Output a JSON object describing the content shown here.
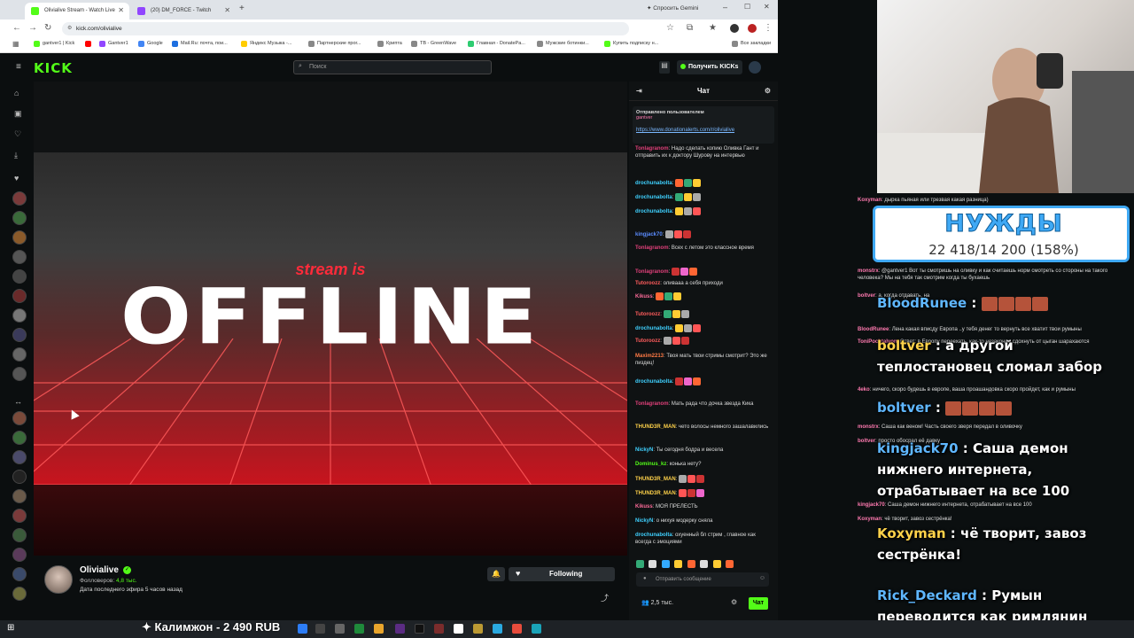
{
  "browser": {
    "tabs": [
      {
        "label": "Olivialive Stream - Watch Live",
        "color": "#53fc18"
      },
      {
        "label": "(20) DM_FORCE - Twitch",
        "color": "#9146ff"
      }
    ],
    "new_tab": "+",
    "gemini_label": "Спросить Gemini",
    "url": "kick.com/olivialive",
    "bookmarks": [
      {
        "label": "gantver1 | Kick",
        "color": "#53fc18"
      },
      {
        "label": "",
        "color": "#ff0000"
      },
      {
        "label": "Gantver1",
        "color": "#9146ff"
      },
      {
        "label": "Google",
        "color": "#4285f4"
      },
      {
        "label": "Mail.Ru: почта, пои...",
        "color": "#1d6fe0"
      },
      {
        "label": "Яндекс Музыка -...",
        "color": "#ffcc00"
      },
      {
        "label": "Партнерские прог...",
        "color": "#888888"
      },
      {
        "label": "Крипта",
        "color": "#888888"
      },
      {
        "label": "TB - GreenWave",
        "color": "#888888"
      },
      {
        "label": "Главная - DonatePa...",
        "color": "#2ecc71"
      },
      {
        "label": "Мужские ботинки...",
        "color": "#888888"
      },
      {
        "label": "Купить подписку н...",
        "color": "#53fc18"
      },
      {
        "label": "Все закладки",
        "color": "#888888"
      }
    ]
  },
  "kick": {
    "logo": "KICK",
    "search_placeholder": "Поиск",
    "get_kicks": "Получить KICKs"
  },
  "video": {
    "stream_is": "stream is",
    "offline": "OFFLINE"
  },
  "channel": {
    "name": "Olivialive",
    "followers_label": "Фолловеров:",
    "followers_value": "4,8 тыс.",
    "last_live": "Дата последнего эфира 5 часов назад",
    "follow_label": "Following"
  },
  "chat": {
    "title": "Чат",
    "pinned_by": "Отправлено пользователем",
    "pinned_user": "gantver",
    "pinned_link": "https://www.donationalerts.com/r/olivialive",
    "messages": [
      {
        "user": "Tonlagranom",
        "color": "#e0407a",
        "text": "Надо сделать копию Оливка Гант и отправить их к доктору Шурову на интервью"
      },
      {
        "user": "drochunabolta",
        "color": "#3fd1ff",
        "text": ""
      },
      {
        "user": "drochunabolta",
        "color": "#3fd1ff",
        "text": ""
      },
      {
        "user": "drochunabolta",
        "color": "#3fd1ff",
        "text": ""
      },
      {
        "user": "kingjack70",
        "color": "#5b8cff",
        "text": ""
      },
      {
        "user": "Tonlagranom",
        "color": "#e0407a",
        "text": "Всех с летом это классное время"
      },
      {
        "user": "Tonlagranom",
        "color": "#e0407a",
        "text": ""
      },
      {
        "user": "Tutoroozz",
        "color": "#ff5c5c",
        "text": "оливааа а себя приходи"
      },
      {
        "user": "Kikuss",
        "color": "#ff6b9a",
        "text": ""
      },
      {
        "user": "Tutoroozz",
        "color": "#ff5c5c",
        "text": ""
      },
      {
        "user": "drochunabolta",
        "color": "#3fd1ff",
        "text": ""
      },
      {
        "user": "Tutoroozz",
        "color": "#ff5c5c",
        "text": ""
      },
      {
        "user": "Maxim2213",
        "color": "#ff7a45",
        "text": "Твоя мать твои стримы смотрит? Это же пиздец!"
      },
      {
        "user": "drochunabolta",
        "color": "#3fd1ff",
        "text": ""
      },
      {
        "user": "Tonlagranom",
        "color": "#e0407a",
        "text": "Мать рада что дочка звезда Кика"
      },
      {
        "user": "THUND3R_MAN",
        "color": "#ffd24a",
        "text": "чето волосы немного зашалавились"
      },
      {
        "user": "NickyN",
        "color": "#3fd1ff",
        "text": "Ты сегодня бодра и весела"
      },
      {
        "user": "Dominus_kz",
        "color": "#53fc18",
        "text": "конька нету?"
      },
      {
        "user": "THUND3R_MAN",
        "color": "#ffd24a",
        "text": ""
      },
      {
        "user": "THUND3R_MAN",
        "color": "#ffd24a",
        "text": ""
      },
      {
        "user": "Kikuss",
        "color": "#ff6b9a",
        "text": "МОЯ ПРЕЛЕСТЬ"
      },
      {
        "user": "NickyN",
        "color": "#3fd1ff",
        "text": "о нихуя модерку сняла"
      },
      {
        "user": "drochunabolta",
        "color": "#3fd1ff",
        "text": "охуенный бл стрим , главное как всегда с эмоциями"
      }
    ],
    "input_placeholder": "Отправить сообщение",
    "viewers": "2,5 тыс.",
    "chat_button": "Чат"
  },
  "overlay": {
    "goal_title": "НУЖДЫ",
    "goal_value": "22 418/14 200 (158%)",
    "small_messages": [
      {
        "user": "Koxyman",
        "text": "дырка пьяная или трезвая какая разница)"
      },
      {
        "user": "monstrx",
        "text": "@gantver1 Вот ты смотришь на оливку и как считаешь норм смотреть со стороны на такого человека? Мы на тебя так смотрим когда ты бухаешь"
      },
      {
        "user": "boltver",
        "text": "а, когда отдавать, на"
      },
      {
        "user": "BloodRunee",
        "text": "Лена какая вписду Европа ..у тебя денег то вернуть все хватит твои румыны"
      },
      {
        "user": "ToniPochtalyon",
        "text": "Ответ: в Европу переехать, как-то незаконно сдохнуть от цыган шарахаются"
      },
      {
        "user": "4eko",
        "text": "ничего, скоро будешь в европе, ваша проашандовка скоро пройдет, как и румыны"
      },
      {
        "user": "monstrx",
        "text": "Саша как веном! Часть своего зверя передал в оливочку"
      },
      {
        "user": "boltver",
        "text": "просто обосрал её давку"
      },
      {
        "user": "kingjack70",
        "text": "Саша демон нижнего интернета, отрабатывает на все 100"
      },
      {
        "user": "Koxyman",
        "text": "чё творит, завоз сестрёнка!"
      }
    ],
    "big_messages": [
      {
        "user": "BloodRunee",
        "text": ""
      },
      {
        "user": "boltver",
        "text": "а другой теплостановец сломал забор"
      },
      {
        "user": "boltver",
        "text": ""
      },
      {
        "user": "kingjack70",
        "text": "Саша демон нижнего интернета, отрабатывает на все 100"
      },
      {
        "user": "Koxyman",
        "text": "чё творит, завоз сестрёнка!"
      },
      {
        "user": "Rick_Deckard",
        "text": "Румын переводится как римлянин"
      }
    ]
  },
  "taskbar": {
    "ticker": "Калимжон - 2 490 RUB"
  }
}
